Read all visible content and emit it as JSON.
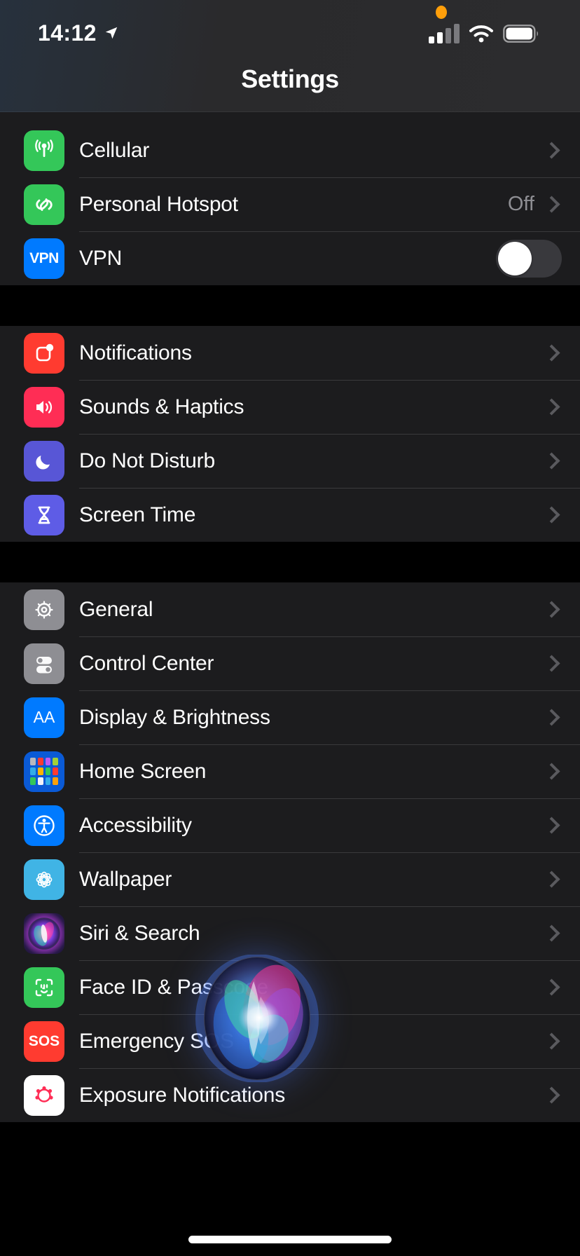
{
  "status_bar": {
    "time": "14:12",
    "location_icon": "location-arrow-icon",
    "mic_indicator": "orange-microphone-dot",
    "cellular_icon": "cellular-signal-icon",
    "cellular_bars_filled": 2,
    "cellular_bars_total": 4,
    "wifi_icon": "wifi-icon",
    "battery_icon": "battery-full-icon"
  },
  "header": {
    "title": "Settings"
  },
  "groups": [
    {
      "id": "connectivity",
      "rows": [
        {
          "label": "Cellular",
          "icon": "cellular-antenna-icon",
          "icon_class": "ic-cellular",
          "accessory": "chevron",
          "value": ""
        },
        {
          "label": "Personal Hotspot",
          "icon": "hotspot-link-icon",
          "icon_class": "ic-hotspot",
          "accessory": "chevron",
          "value": "Off"
        },
        {
          "label": "VPN",
          "icon": "vpn-icon",
          "icon_class": "ic-vpn",
          "accessory": "toggle",
          "toggle_state": "off",
          "icon_text": "VPN"
        }
      ]
    },
    {
      "id": "alerts",
      "rows": [
        {
          "label": "Notifications",
          "icon": "notifications-badge-icon",
          "icon_class": "ic-notif",
          "accessory": "chevron",
          "value": ""
        },
        {
          "label": "Sounds & Haptics",
          "icon": "speaker-waves-icon",
          "icon_class": "ic-sounds",
          "accessory": "chevron",
          "value": ""
        },
        {
          "label": "Do Not Disturb",
          "icon": "moon-icon",
          "icon_class": "ic-dnd",
          "accessory": "chevron",
          "value": ""
        },
        {
          "label": "Screen Time",
          "icon": "hourglass-icon",
          "icon_class": "ic-screen",
          "accessory": "chevron",
          "value": ""
        }
      ]
    },
    {
      "id": "system",
      "rows": [
        {
          "label": "General",
          "icon": "gear-icon",
          "icon_class": "ic-general",
          "accessory": "chevron",
          "value": ""
        },
        {
          "label": "Control Center",
          "icon": "toggles-icon",
          "icon_class": "ic-control",
          "accessory": "chevron",
          "value": ""
        },
        {
          "label": "Display & Brightness",
          "icon": "text-size-icon",
          "icon_class": "ic-display",
          "accessory": "chevron",
          "value": "",
          "icon_text": "AA"
        },
        {
          "label": "Home Screen",
          "icon": "app-grid-icon",
          "icon_class": "ic-home",
          "accessory": "chevron",
          "value": ""
        },
        {
          "label": "Accessibility",
          "icon": "accessibility-person-icon",
          "icon_class": "ic-access",
          "accessory": "chevron",
          "value": ""
        },
        {
          "label": "Wallpaper",
          "icon": "flower-rosette-icon",
          "icon_class": "ic-wall",
          "accessory": "chevron",
          "value": ""
        },
        {
          "label": "Siri & Search",
          "icon": "siri-orb-icon",
          "icon_class": "ic-siri",
          "accessory": "chevron",
          "value": ""
        },
        {
          "label": "Face ID & Passcode",
          "icon": "face-id-icon",
          "icon_class": "ic-faceid",
          "accessory": "chevron",
          "value": ""
        },
        {
          "label": "Emergency SOS",
          "icon": "sos-icon",
          "icon_class": "ic-sos",
          "accessory": "chevron",
          "value": "",
          "icon_text": "SOS"
        },
        {
          "label": "Exposure Notifications",
          "icon": "exposure-virus-icon",
          "icon_class": "ic-exposure",
          "accessory": "chevron",
          "value": ""
        }
      ]
    }
  ],
  "overlay": {
    "siri_orb": "siri-listening-orb"
  },
  "home_indicator": "home-indicator-bar",
  "colors": {
    "background": "#000000",
    "row_background": "#1c1c1e",
    "separator": "#3a3a3c",
    "label_text": "#ffffff",
    "secondary_text": "#8e8e93",
    "chevron": "#5a5a5e",
    "accent_blue": "#007aff",
    "accent_green": "#34c759",
    "accent_red": "#ff3b30",
    "accent_pink": "#ff2d55",
    "accent_purple": "#5856d6",
    "accent_gray": "#8e8e93",
    "mic_orange": "#ff9f0a"
  }
}
